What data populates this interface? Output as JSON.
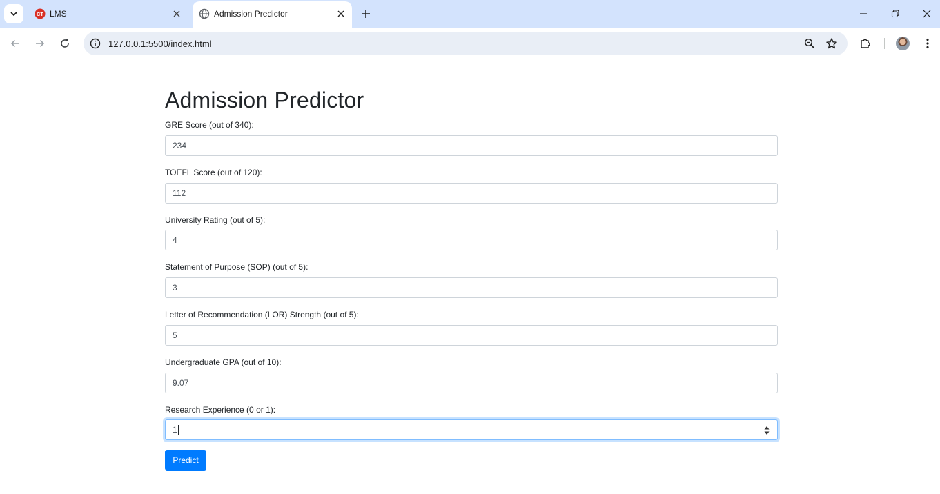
{
  "browser": {
    "tabs": [
      {
        "title": "LMS",
        "favicon": "lms-favicon",
        "active": false
      },
      {
        "title": "Admission Predictor",
        "favicon": "globe-icon",
        "active": true
      }
    ],
    "address_bar": {
      "url": "127.0.0.1:5500/index.html"
    }
  },
  "page": {
    "title": "Admission Predictor",
    "fields": [
      {
        "label": "GRE Score (out of 340):",
        "value": "234"
      },
      {
        "label": "TOEFL Score (out of 120):",
        "value": "112"
      },
      {
        "label": "University Rating (out of 5):",
        "value": "4"
      },
      {
        "label": "Statement of Purpose (SOP) (out of 5):",
        "value": "3"
      },
      {
        "label": "Letter of Recommendation (LOR) Strength (out of 5):",
        "value": "5"
      },
      {
        "label": "Undergraduate GPA (out of 10):",
        "value": "9.07"
      },
      {
        "label": "Research Experience (0 or 1):",
        "value": "1"
      }
    ],
    "submit_label": "Predict"
  },
  "colors": {
    "tabstrip_bg": "#d3e3fd",
    "primary_button": "#007bff",
    "focus_ring": "#80bdff",
    "lms_favicon": "#d93025"
  }
}
